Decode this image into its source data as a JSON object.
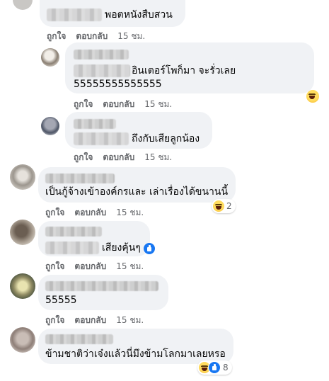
{
  "comments": [
    {
      "text_lines": [
        "พอตหนังสืบสวน"
      ],
      "actions": {
        "like": "ถูกใจ",
        "reply": "ตอบกลับ",
        "time": "15 ชม."
      }
    },
    {
      "text_lines": [
        "อินเตอร์โพก็มา จะรั่วเลย",
        "55555555555555"
      ],
      "actions": {
        "like": "ถูกใจ",
        "reply": "ตอบกลับ",
        "time": "15 ชม."
      },
      "reaction": {
        "icons": [
          "haha-icon"
        ],
        "count": ""
      }
    },
    {
      "text_lines": [
        "ถึงกับเสียลูกน้อง"
      ],
      "actions": {
        "like": "ถูกใจ",
        "reply": "ตอบกลับ",
        "time": "15 ชม."
      }
    },
    {
      "text_lines": [
        "เป็นกู้จ้างเข้าองค์กรและ เล่าเรื่องได้ขนานนี้"
      ],
      "actions": {
        "like": "ถูกใจ",
        "reply": "ตอบกลับ",
        "time": "15 ชม."
      },
      "reaction": {
        "icons": [
          "haha-icon"
        ],
        "count": "2"
      }
    },
    {
      "text_lines": [
        "เสียงคุ้นๆ"
      ],
      "actions": {
        "like": "ถูกใจ",
        "reply": "ตอบกลับ",
        "time": "15 ชม."
      },
      "reaction": {
        "icons": [
          "like-icon"
        ],
        "count": ""
      }
    },
    {
      "text_lines": [
        "55555"
      ],
      "actions": {
        "like": "ถูกใจ",
        "reply": "ตอบกลับ",
        "time": "15 ชม."
      }
    },
    {
      "text_lines": [
        "ข้ามชาติว่าเจ๋งแล้วนี่มึงข้ามโลกมาเลยหรอ"
      ],
      "actions": {},
      "reaction": {
        "icons": [
          "haha-icon",
          "like-icon"
        ],
        "count": "8"
      }
    }
  ],
  "colors": {
    "bubble": "#f0f2f5",
    "meta": "#65676b",
    "text": "#050505",
    "like_blue": "#1877f2",
    "haha_yellow": "#f7b125"
  }
}
